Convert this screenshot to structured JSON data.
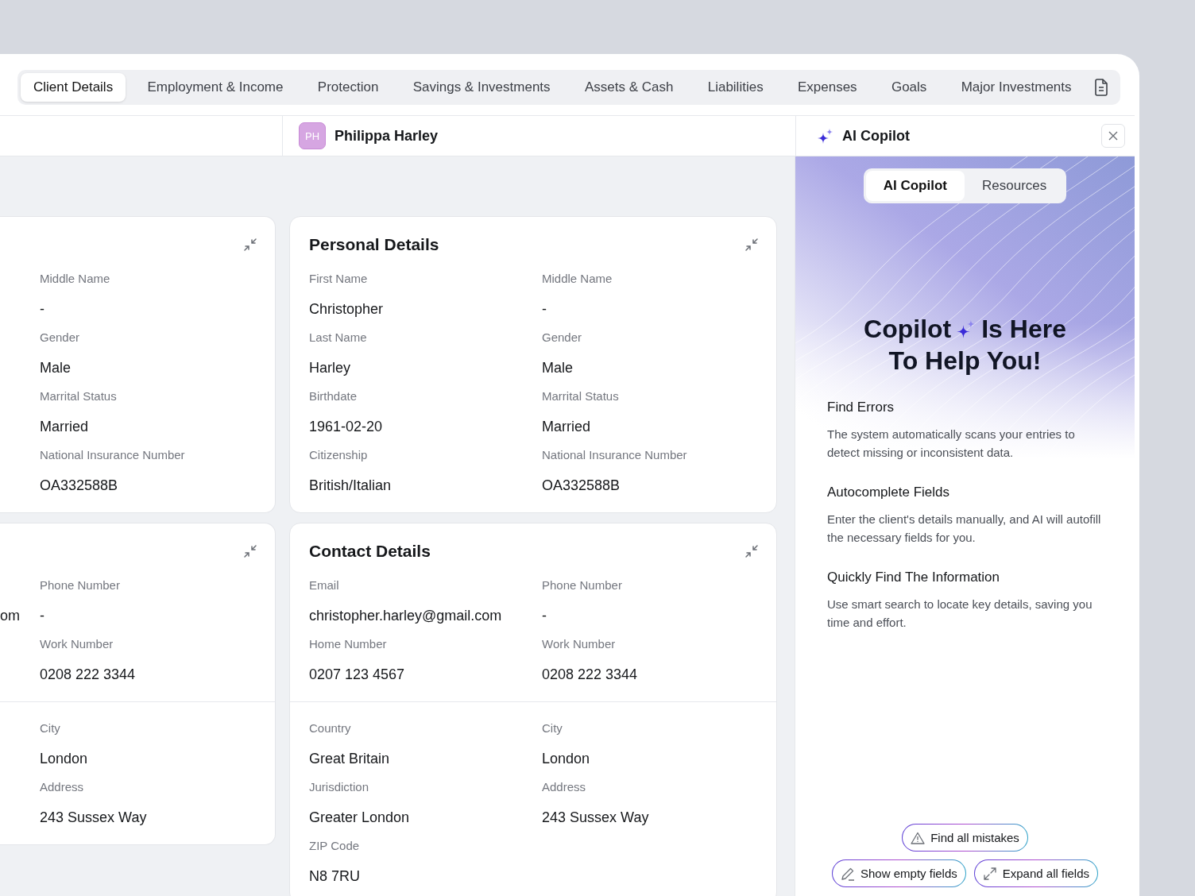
{
  "tabs": [
    {
      "label": "Client Details",
      "selected": true
    },
    {
      "label": "Employment & Income",
      "selected": false
    },
    {
      "label": "Protection",
      "selected": false
    },
    {
      "label": "Savings & Investments",
      "selected": false
    },
    {
      "label": "Assets & Cash",
      "selected": false
    },
    {
      "label": "Liabilities",
      "selected": false
    },
    {
      "label": "Expenses",
      "selected": false
    },
    {
      "label": "Goals",
      "selected": false
    },
    {
      "label": "Major Investments",
      "selected": false
    }
  ],
  "client": {
    "initials": "PH",
    "name": "Philippa Harley"
  },
  "left_cards": [
    {
      "sections": [
        {
          "fields": [
            {
              "label": "Middle Name",
              "value": "-"
            },
            {
              "label": "Gender",
              "value": "Male"
            },
            {
              "label": "Marrital Status",
              "value": "Married"
            },
            {
              "label": "National Insurance Number",
              "value": "OA332588B"
            }
          ]
        }
      ]
    },
    {
      "sections": [
        {
          "fields": [
            {
              "label": "Phone Number",
              "value": "-",
              "cut_text": "om"
            },
            {
              "label": "Work Number",
              "value": "0208 222 3344"
            }
          ]
        },
        {
          "fields": [
            {
              "label": "City",
              "value": "London"
            },
            {
              "label": "Address",
              "value": "243 Sussex Way"
            }
          ]
        }
      ]
    }
  ],
  "cards": [
    {
      "title": "Personal Details",
      "sections": [
        {
          "fields": [
            {
              "label": "First Name",
              "value": "Christopher"
            },
            {
              "label": "Middle Name",
              "value": "-"
            },
            {
              "label": "Last Name",
              "value": "Harley"
            },
            {
              "label": "Gender",
              "value": "Male"
            },
            {
              "label": "Birthdate",
              "value": "1961-02-20"
            },
            {
              "label": "Marrital Status",
              "value": "Married"
            },
            {
              "label": "Citizenship",
              "value": "British/Italian"
            },
            {
              "label": "National Insurance Number",
              "value": "OA332588B"
            }
          ]
        }
      ]
    },
    {
      "title": "Contact Details",
      "sections": [
        {
          "fields": [
            {
              "label": "Email",
              "value": "christopher.harley@gmail.com"
            },
            {
              "label": "Phone Number",
              "value": "-"
            },
            {
              "label": "Home Number",
              "value": "0207 123 4567"
            },
            {
              "label": "Work Number",
              "value": "0208 222 3344"
            }
          ]
        },
        {
          "fields": [
            {
              "label": "Country",
              "value": "Great Britain"
            },
            {
              "label": "City",
              "value": "London"
            },
            {
              "label": "Jurisdiction",
              "value": "Greater London"
            },
            {
              "label": "Address",
              "value": "243 Sussex Way"
            },
            {
              "label": "ZIP Code",
              "value": "N8 7RU"
            }
          ]
        }
      ]
    }
  ],
  "copilot": {
    "title": "AI Copilot",
    "tabs": [
      {
        "label": "AI Copilot",
        "selected": true
      },
      {
        "label": "Resources",
        "selected": false
      }
    ],
    "heading": [
      "Copilot",
      "Is Here",
      "To Help You!"
    ],
    "features": [
      {
        "title": "Find Errors",
        "text": "The system automatically scans your entries to detect missing or inconsistent data."
      },
      {
        "title": "Autocomplete Fields",
        "text": "Enter the client's details manually, and AI will autofill the necessary fields for you."
      },
      {
        "title": "Quickly Find The Information",
        "text": "Use smart search to locate key details, saving you time and effort."
      }
    ],
    "actions": [
      {
        "kind": "warning",
        "label": "Find all mistakes"
      },
      {
        "kind": "edit",
        "label": "Show empty fields"
      },
      {
        "kind": "expand",
        "label": "Expand all fields"
      }
    ]
  }
}
